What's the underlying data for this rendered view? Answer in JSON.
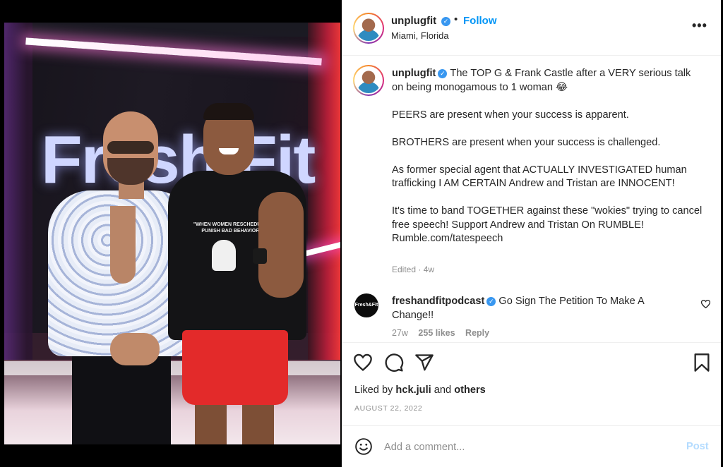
{
  "post": {
    "username": "unplugfit",
    "follow_label": "Follow",
    "location": "Miami, Florida",
    "more_label": "•••",
    "dot": "•"
  },
  "photo": {
    "sign_text": "Fresh Fit",
    "shirt_print": "\"WHEN WOMEN RESCHEDULE I PUNISH BAD BEHAVIOR\""
  },
  "caption": {
    "username": "unplugfit",
    "line1": "The TOP G & Frank Castle after a VERY serious talk on being monogamous to 1 woman 😂",
    "para2": "PEERS are present when your success is apparent.",
    "para3": "BROTHERS are present when your success is challenged.",
    "para4": "As former special agent that ACTUALLY INVESTIGATED human trafficking I AM CERTAIN Andrew and Tristan are INNOCENT!",
    "para5": "It's time to band TOGETHER against these \"wokies\" trying to cancel free speech! Support Andrew and Tristan On RUMBLE! Rumble.com/tatespeech",
    "edited": "Edited · 4w"
  },
  "comment": {
    "avatar_text": "Fresh&Fit",
    "username": "freshandfitpodcast",
    "text": "Go Sign The Petition To Make A Change!!",
    "age": "27w",
    "likes": "255 likes",
    "reply": "Reply"
  },
  "actions": {
    "liked_by_prefix": "Liked by",
    "liked_by_user": "hck.juli",
    "liked_by_and": "and",
    "liked_by_others": "others",
    "date": "AUGUST 22, 2022"
  },
  "add_comment": {
    "placeholder": "Add a comment...",
    "post_label": "Post"
  },
  "colors": {
    "link_blue": "#0095f6",
    "verified_blue": "#3897f0",
    "post_disabled": "#b3dbff",
    "muted_text": "#8e8e8e"
  },
  "icons": [
    "heart-icon",
    "comment-icon",
    "share-icon",
    "bookmark-icon",
    "emoji-icon",
    "more-icon",
    "verified-badge-icon"
  ]
}
